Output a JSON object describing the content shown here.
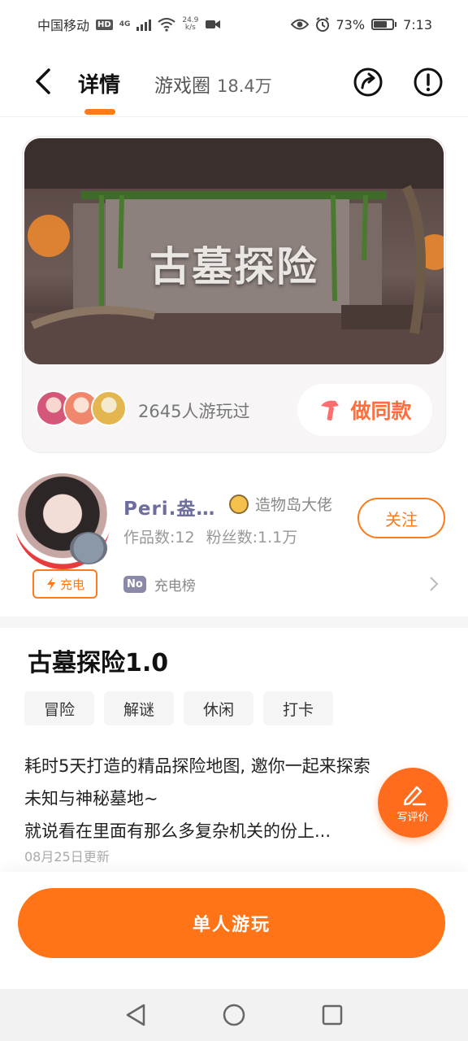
{
  "status_bar": {
    "carrier": "中国移动",
    "hd": "HD",
    "net_type": "4G",
    "speed_value": "24.9",
    "speed_unit": "k/s",
    "battery": "73%",
    "time": "7:13"
  },
  "nav": {
    "tab_detail": "详情",
    "tab_circle": "游戏圈",
    "circle_count": "18.4万"
  },
  "game_card": {
    "cover_title": "古墓探险",
    "played_text": "2645人游玩过",
    "same_button": "做同款"
  },
  "author": {
    "name": "Peri.盎…",
    "role": "造物岛大佬",
    "works": "作品数:12",
    "fans": "粉丝数:1.1万",
    "follow": "关注",
    "charge_tag": "充电",
    "rank_badge": "No",
    "rank_label": "充电榜"
  },
  "game": {
    "title": "古墓探险1.0",
    "tags": [
      "冒险",
      "解谜",
      "休闲",
      "打卡"
    ],
    "desc_line1": "耗时5天打造的精品探险地图, 邀你一起来探索",
    "desc_line2": "未知与神秘墓地~",
    "desc_line3": "就说看在里面有那么多复杂机关的份上...",
    "updated": "08月25日更新"
  },
  "review_fab": "写评价",
  "play_button": "单人游玩",
  "colors": {
    "accent": "#ff7416",
    "accent_text": "#ff6e3c"
  }
}
